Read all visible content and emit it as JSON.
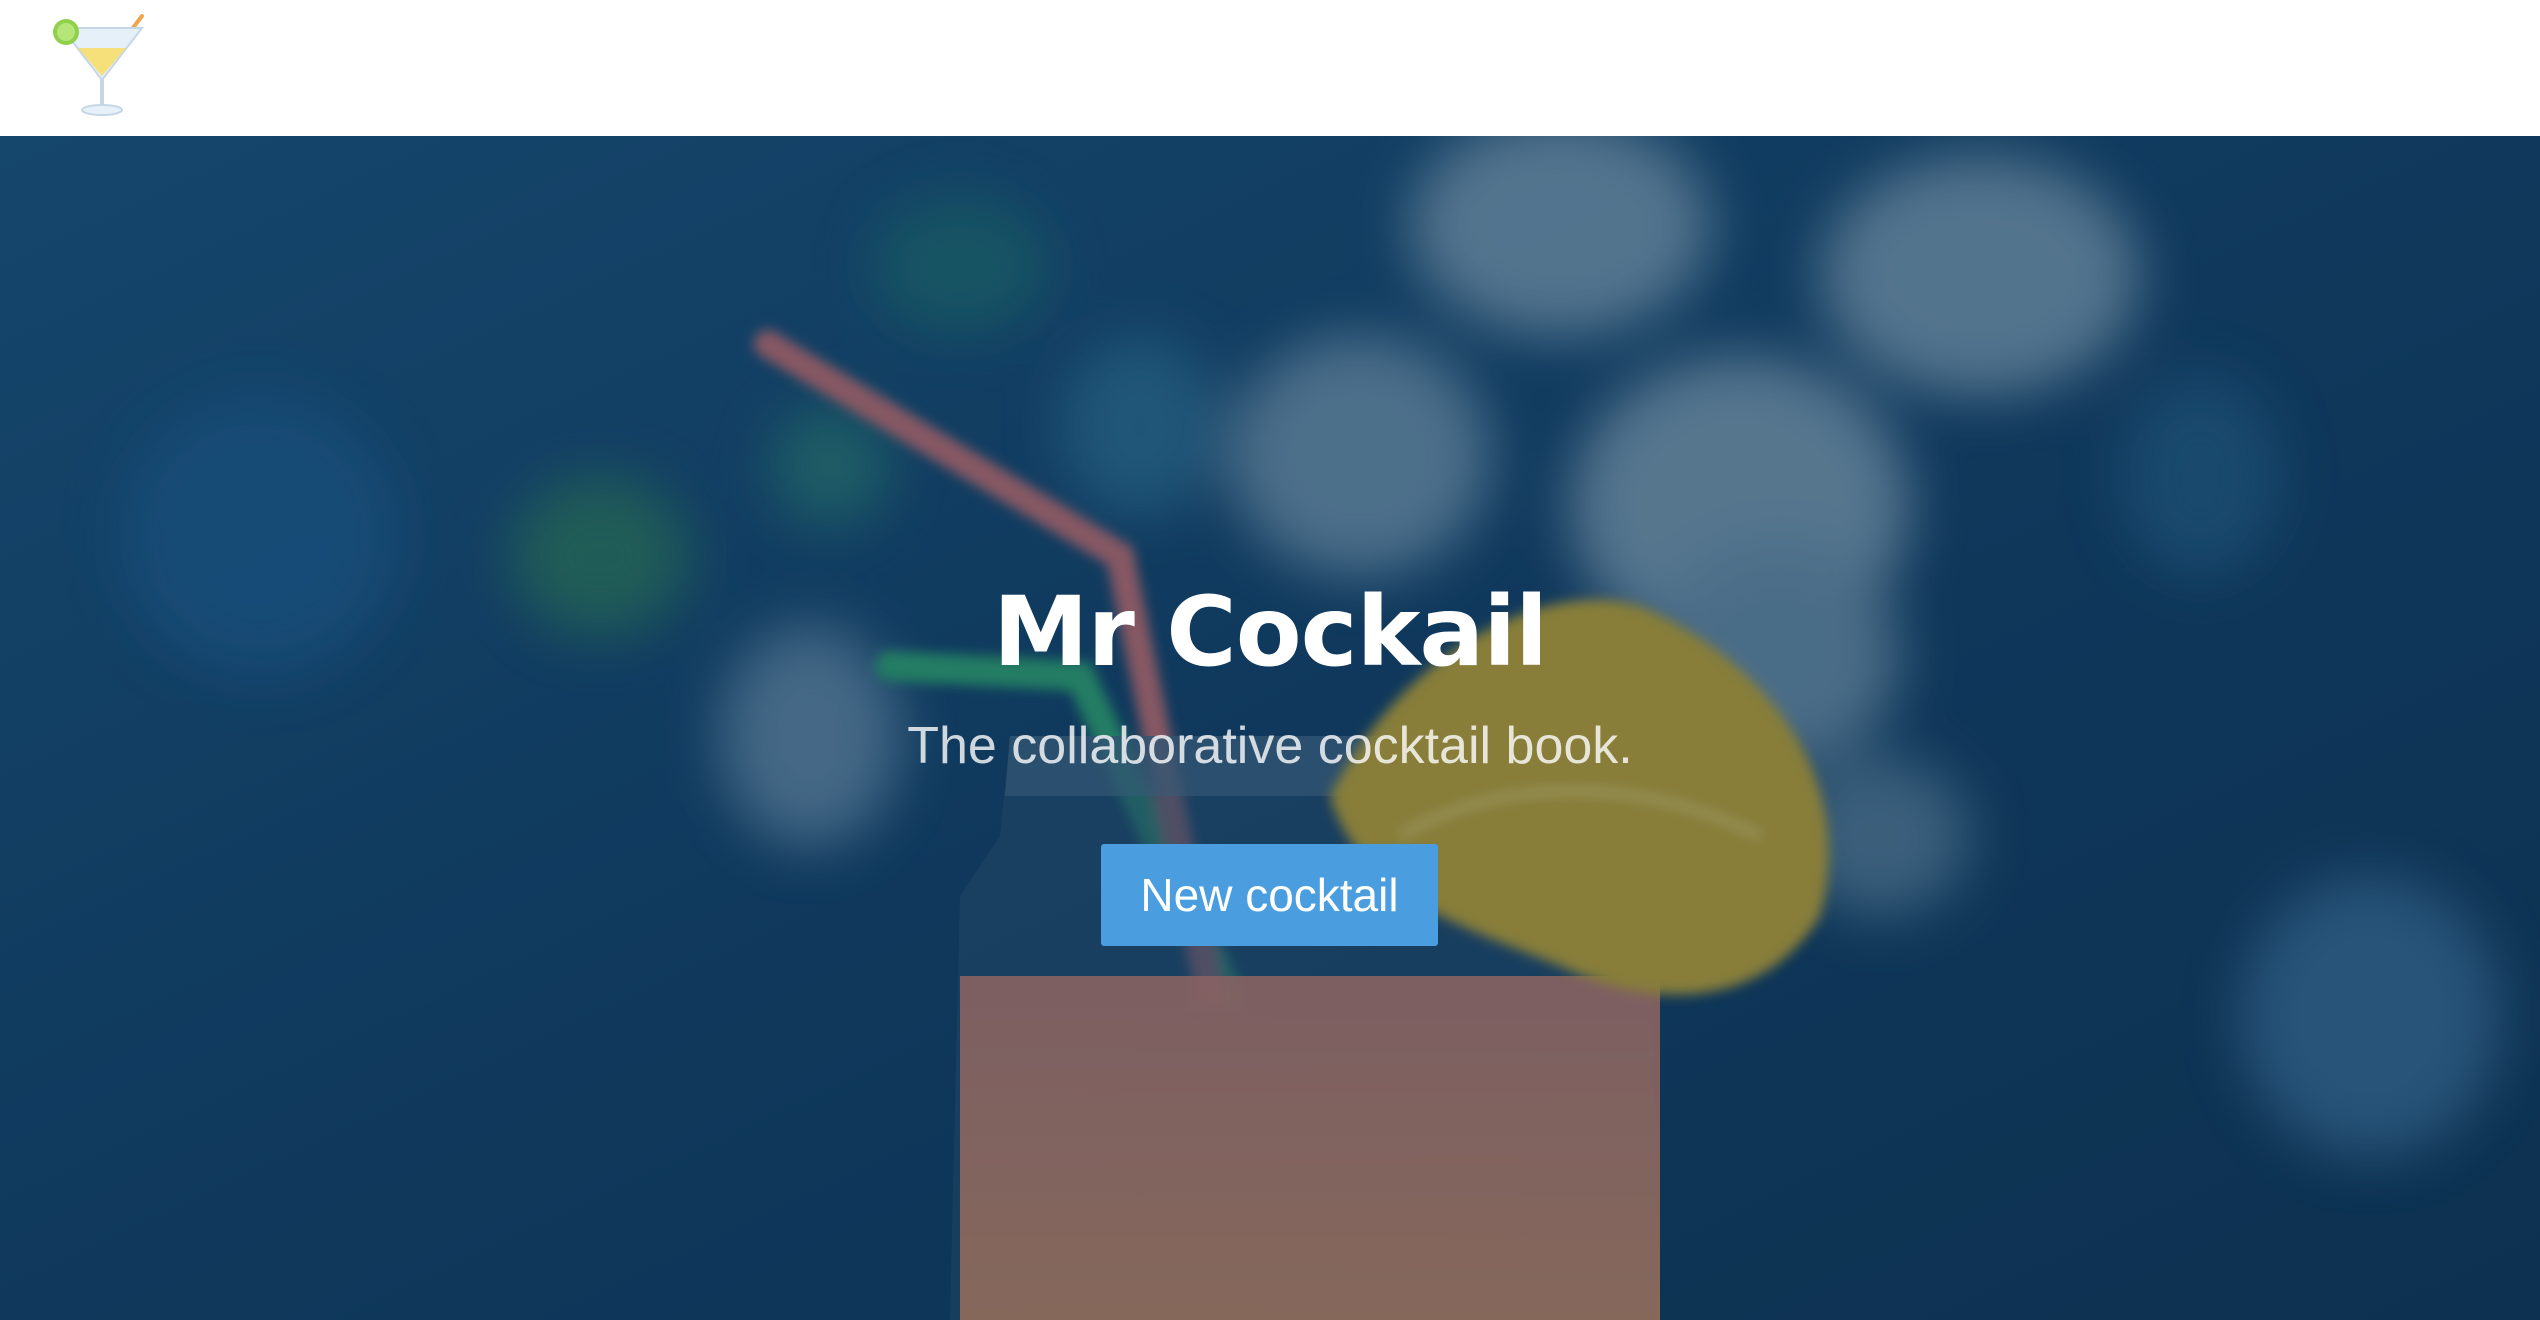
{
  "navbar": {
    "logo_icon": "cocktail-glass-icon"
  },
  "hero": {
    "title": "Mr Cockail",
    "subtitle": "The collaborative cocktail book.",
    "cta_label": "New cocktail",
    "background_image": "cocktail-jar-photo"
  },
  "colors": {
    "hero_overlay": "#11385a",
    "button": "#4a9ee0",
    "title": "#ffffff",
    "navbar": "#ffffff"
  }
}
